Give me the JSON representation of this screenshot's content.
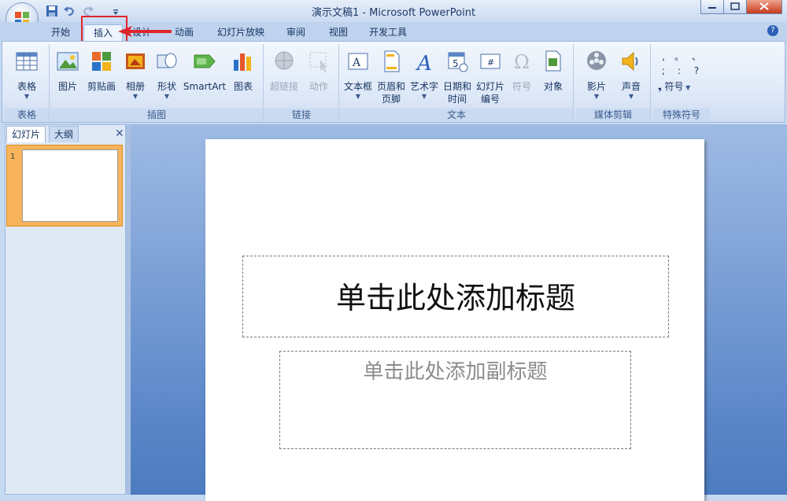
{
  "window": {
    "title": "演示文稿1 - Microsoft PowerPoint"
  },
  "tabs": [
    {
      "label": "开始"
    },
    {
      "label": "插入"
    },
    {
      "label": "设计"
    },
    {
      "label": "动画"
    },
    {
      "label": "幻灯片放映"
    },
    {
      "label": "审阅"
    },
    {
      "label": "视图"
    },
    {
      "label": "开发工具"
    }
  ],
  "ribbon": {
    "table": {
      "btn": "表格",
      "group": "表格"
    },
    "illustrations": {
      "picture": "图片",
      "clipart": "剪贴画",
      "album": "相册",
      "shapes": "形状",
      "smartart": "SmartArt",
      "chart": "图表",
      "group": "插图"
    },
    "links": {
      "hyperlink": "超链接",
      "action": "动作",
      "group": "链接"
    },
    "text": {
      "textbox": "文本框",
      "header1": "页眉和",
      "header2": "页脚",
      "wordart": "艺术字",
      "date1": "日期和",
      "date2": "时间",
      "slidenum1": "幻灯片",
      "slidenum2": "编号",
      "symbol": "符号",
      "object": "对象",
      "group": "文本"
    },
    "media": {
      "movie": "影片",
      "sound": "声音",
      "group": "媒体剪辑"
    },
    "special": {
      "symbol": "符号",
      "group": "特殊符号",
      "chars": [
        ",",
        "。",
        "、",
        ";",
        ":",
        "?"
      ]
    }
  },
  "pane": {
    "slides_tab": "幻灯片",
    "outline_tab": "大纲",
    "close": "✕",
    "slide_number": "1"
  },
  "slide": {
    "title_placeholder": "单击此处添加标题",
    "subtitle_placeholder": "单击此处添加副标题"
  },
  "colors": {
    "highlight": "#e0252a",
    "ribbon_bg": "#dce7f7",
    "canvas": "#5a86c8"
  }
}
